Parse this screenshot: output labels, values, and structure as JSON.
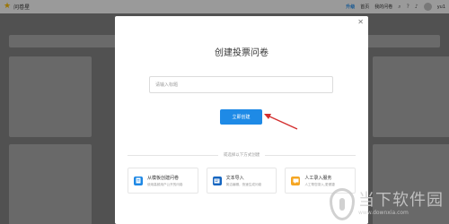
{
  "header": {
    "brand_icon": "star-icon",
    "brand_name": "问卷星",
    "upgrade_label": "升级",
    "nav_item_1": "首页",
    "nav_item_2": "我的问卷",
    "user_name": "yu1",
    "icons": [
      "search-icon",
      "help-icon",
      "bell-icon"
    ]
  },
  "modal": {
    "title": "创建投票问卷",
    "input_placeholder": "请输入标题",
    "create_label": "立即创建",
    "divider_text": "或选择以下方式创建",
    "options": [
      {
        "icon": "doc-icon",
        "title": "从模板创建问卷",
        "desc": "使用高频用户公开的问卷"
      },
      {
        "icon": "text-import-icon",
        "title": "文本导入",
        "desc": "简洁编辑，快速生成问卷"
      },
      {
        "icon": "service-icon",
        "title": "人工录入服务",
        "desc": "人工帮您录入,更便捷"
      }
    ]
  },
  "colors": {
    "accent": "#1e8ae6",
    "arrow": "#d32f2f",
    "option_icon_1": "#1e88e5",
    "option_icon_2": "#1565c0",
    "option_icon_3": "#f5a623"
  },
  "watermark": {
    "title": "当下软件园",
    "url": "www.downxia.com"
  }
}
